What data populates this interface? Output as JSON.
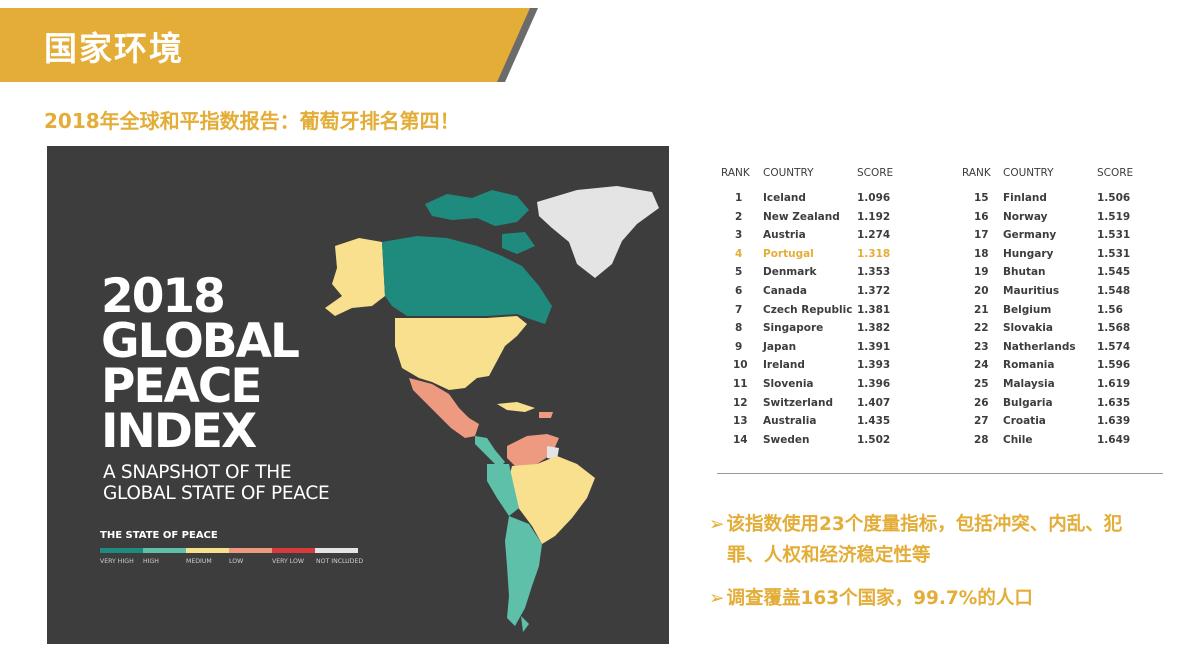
{
  "header": {
    "title": "国家环境"
  },
  "subtitle": "2018年全球和平指数报告：葡萄牙排名第四！",
  "map_panel": {
    "title_lines": [
      "2018",
      "GLOBAL",
      "PEACE",
      "INDEX"
    ],
    "subtitle_lines": [
      "A SNAPSHOT OF THE",
      "GLOBAL STATE OF PEACE"
    ],
    "legend_title": "THE STATE OF PEACE",
    "legend": [
      {
        "label": "VERY HIGH",
        "color": "#1f8a7e"
      },
      {
        "label": "HIGH",
        "color": "#5fc0aa"
      },
      {
        "label": "MEDIUM",
        "color": "#f8e08e"
      },
      {
        "label": "LOW",
        "color": "#ee9a80"
      },
      {
        "label": "VERY LOW",
        "color": "#d93a3e"
      },
      {
        "label": "NOT INCLUDED",
        "color": "#e4e4e4"
      }
    ]
  },
  "ranking": {
    "headers": {
      "rank": "RANK",
      "country": "COUNTRY",
      "score": "SCORE"
    },
    "left": [
      {
        "rank": "1",
        "country": "Iceland",
        "score": "1.096"
      },
      {
        "rank": "2",
        "country": "New Zealand",
        "score": "1.192"
      },
      {
        "rank": "3",
        "country": "Austria",
        "score": "1.274"
      },
      {
        "rank": "4",
        "country": "Portugal",
        "score": "1.318"
      },
      {
        "rank": "5",
        "country": "Denmark",
        "score": "1.353"
      },
      {
        "rank": "6",
        "country": "Canada",
        "score": "1.372"
      },
      {
        "rank": "7",
        "country": "Czech Republic",
        "score": "1.381"
      },
      {
        "rank": "8",
        "country": "Singapore",
        "score": "1.382"
      },
      {
        "rank": "9",
        "country": "Japan",
        "score": "1.391"
      },
      {
        "rank": "10",
        "country": "Ireland",
        "score": "1.393"
      },
      {
        "rank": "11",
        "country": "Slovenia",
        "score": "1.396"
      },
      {
        "rank": "12",
        "country": "Switzerland",
        "score": "1.407"
      },
      {
        "rank": "13",
        "country": "Australia",
        "score": "1.435"
      },
      {
        "rank": "14",
        "country": "Sweden",
        "score": "1.502"
      }
    ],
    "right": [
      {
        "rank": "15",
        "country": "Finland",
        "score": "1.506"
      },
      {
        "rank": "16",
        "country": "Norway",
        "score": "1.519"
      },
      {
        "rank": "17",
        "country": "Germany",
        "score": "1.531"
      },
      {
        "rank": "18",
        "country": "Hungary",
        "score": "1.531"
      },
      {
        "rank": "19",
        "country": "Bhutan",
        "score": "1.545"
      },
      {
        "rank": "20",
        "country": "Mauritius",
        "score": "1.548"
      },
      {
        "rank": "21",
        "country": "Belgium",
        "score": "1.56"
      },
      {
        "rank": "22",
        "country": "Slovakia",
        "score": "1.568"
      },
      {
        "rank": "23",
        "country": "Natherlands",
        "score": "1.574"
      },
      {
        "rank": "24",
        "country": "Romania",
        "score": "1.596"
      },
      {
        "rank": "25",
        "country": "Malaysia",
        "score": "1.619"
      },
      {
        "rank": "26",
        "country": "Bulgaria",
        "score": "1.635"
      },
      {
        "rank": "27",
        "country": "Croatia",
        "score": "1.639"
      },
      {
        "rank": "28",
        "country": "Chile",
        "score": "1.649"
      }
    ],
    "highlight_rank": "4",
    "highlight_color": "#e3ad38"
  },
  "bullets": [
    {
      "arrow": "➢",
      "lines": [
        "该指数使用23个度量指标，包括冲突、内乱、犯",
        "罪、人权和经济稳定性等"
      ]
    },
    {
      "arrow": "➢",
      "lines": [
        "调查覆盖163个国家，99.7%的人口"
      ]
    }
  ],
  "colors": {
    "accent": "#e3ad38",
    "banner_shadow": "#6b6b6b",
    "panel_bg": "#3e3d3e"
  }
}
